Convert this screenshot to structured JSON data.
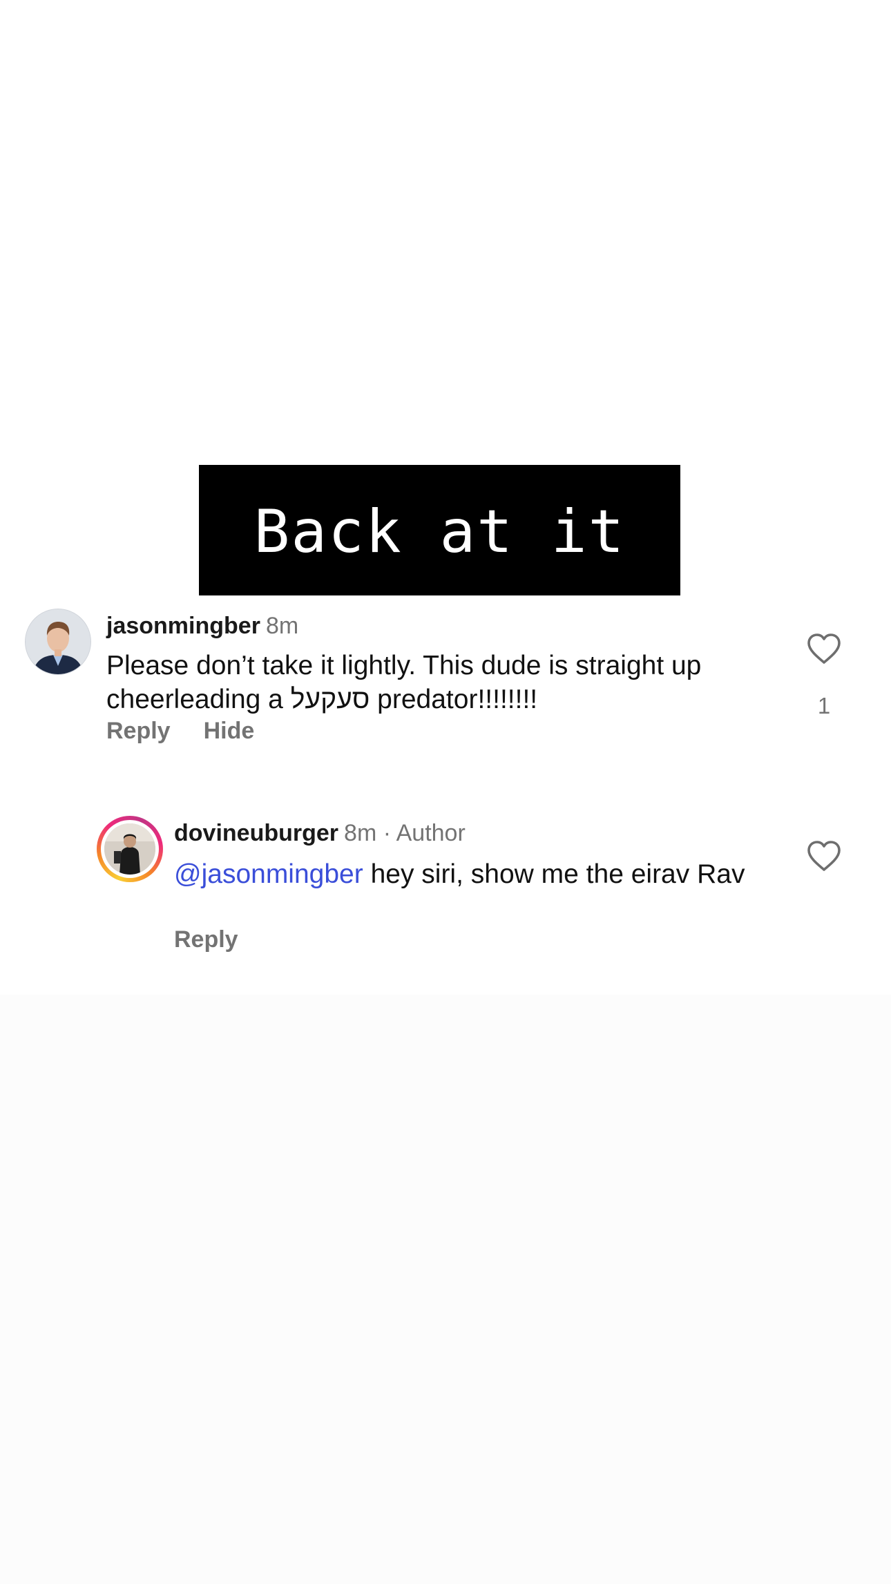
{
  "caption": {
    "text": "Back at it"
  },
  "comments": [
    {
      "username": "jasonmingber",
      "time": "8m",
      "text": "Please don’t take it lightly. This dude is straight up cheerleading a סעקעל predator!!!!!!!!",
      "like_count": "1",
      "actions": [
        "Reply",
        "Hide"
      ],
      "avatar_icon": "avatar-photo"
    }
  ],
  "replies": [
    {
      "username": "dovineuburger",
      "time": "8m",
      "author_tag": "· Author",
      "mention": "@jasonmingber",
      "text": " hey siri, show me the eirav Rav",
      "actions": [
        "Reply"
      ],
      "avatar_icon": "avatar-photo-story-ring"
    }
  ],
  "colors": {
    "mention": "#3a4ed9",
    "secondary_text": "#737373",
    "caption_bg": "#000000",
    "caption_fg": "#ffffff"
  },
  "icons": {
    "like": "heart-outline-icon"
  }
}
